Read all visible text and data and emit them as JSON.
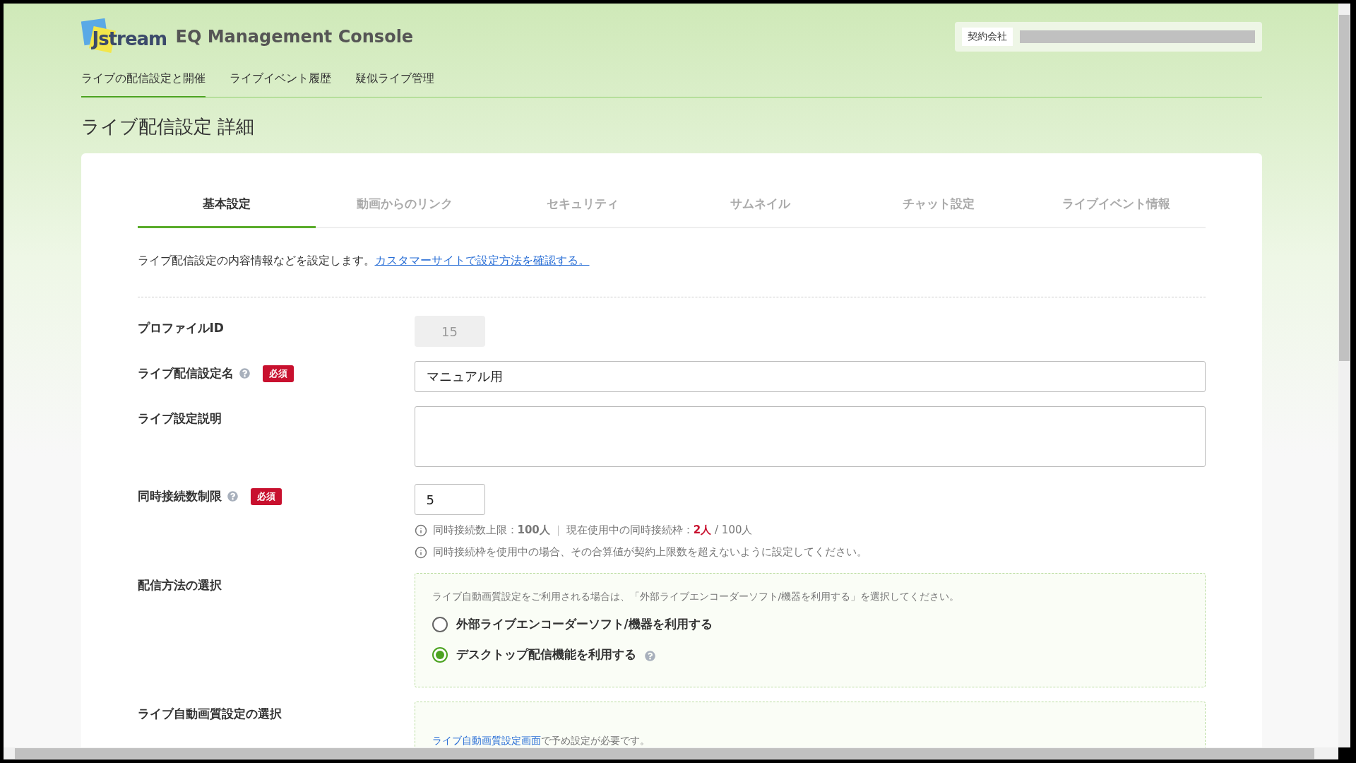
{
  "header": {
    "logo": "Jstream",
    "title": "EQ Management Console",
    "company_label": "契約会社"
  },
  "nav": [
    {
      "label": "ライブの配信設定と開催",
      "selected": true
    },
    {
      "label": "ライブイベント履歴",
      "selected": false
    },
    {
      "label": "疑似ライブ管理",
      "selected": false
    }
  ],
  "page_title": "ライブ配信設定 詳細",
  "tabs": [
    {
      "label": "基本設定",
      "selected": true
    },
    {
      "label": "動画からのリンク",
      "selected": false
    },
    {
      "label": "セキュリティ",
      "selected": false
    },
    {
      "label": "サムネイル",
      "selected": false
    },
    {
      "label": "チャット設定",
      "selected": false
    },
    {
      "label": "ライブイベント情報",
      "selected": false
    }
  ],
  "description": {
    "text": "ライブ配信設定の内容情報などを設定します。",
    "link": "カスタマーサイトで設定方法を確認する。"
  },
  "fields": [
    {
      "kind": "readonly",
      "label": "プロファイルID",
      "help": false,
      "value": "15"
    },
    {
      "kind": "text",
      "label": "ライブ配信設定名",
      "help": true,
      "required_badge": "必須",
      "value": "マニュアル用"
    },
    {
      "kind": "textarea",
      "label": "ライブ設定説明",
      "help": false
    },
    {
      "kind": "number",
      "label": "同時接続数制限",
      "help": true,
      "required_badge": "必須",
      "value": "5",
      "notes": [
        [
          {
            "kind": "plain",
            "text": "同時接続数上限："
          },
          {
            "kind": "bold",
            "text": "100人"
          },
          {
            "kind": "divider",
            "text": "｜"
          },
          {
            "kind": "plain",
            "text": "現在使用中の同時接続枠："
          },
          {
            "kind": "alert",
            "text": "2人"
          },
          {
            "kind": "plain",
            "text": " / 100人"
          }
        ],
        [
          {
            "kind": "plain",
            "text": "同時接続枠を使用中の場合、その合算値が契約上限数を超えないように設定してください。"
          }
        ]
      ]
    },
    {
      "kind": "radio",
      "label": "配信方法の選択",
      "hint": "ライブ自動画質設定をご利用される場合は、「外部ライブエンコーダーソフト/機器を利用する」を選択してください。",
      "options": [
        {
          "label": "外部ライブエンコーダーソフト/機器を利用する",
          "selected": false,
          "help": false
        },
        {
          "label": "デスクトップ配信機能を利用する",
          "selected": true,
          "help": true
        }
      ]
    },
    {
      "kind": "linkbox",
      "label": "ライブ自動画質設定の選択",
      "link": "ライブ自動画質設定画面",
      "text": "で予め設定が必要です。"
    }
  ]
}
